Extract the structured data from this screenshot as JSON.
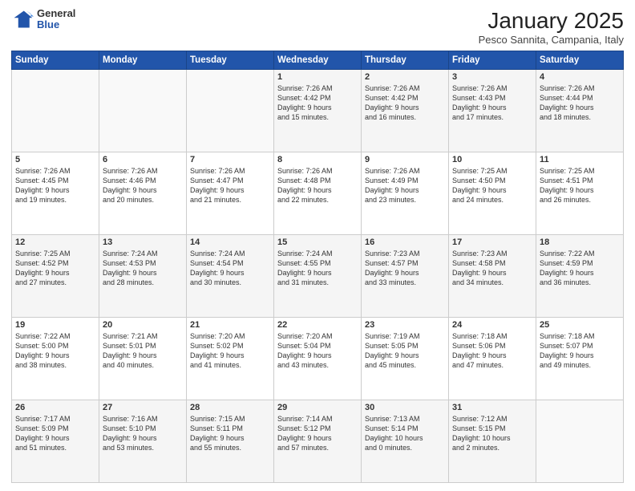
{
  "logo": {
    "general": "General",
    "blue": "Blue"
  },
  "header": {
    "month": "January 2025",
    "location": "Pesco Sannita, Campania, Italy"
  },
  "weekdays": [
    "Sunday",
    "Monday",
    "Tuesday",
    "Wednesday",
    "Thursday",
    "Friday",
    "Saturday"
  ],
  "weeks": [
    [
      {
        "day": "",
        "info": ""
      },
      {
        "day": "",
        "info": ""
      },
      {
        "day": "",
        "info": ""
      },
      {
        "day": "1",
        "info": "Sunrise: 7:26 AM\nSunset: 4:42 PM\nDaylight: 9 hours\nand 15 minutes."
      },
      {
        "day": "2",
        "info": "Sunrise: 7:26 AM\nSunset: 4:42 PM\nDaylight: 9 hours\nand 16 minutes."
      },
      {
        "day": "3",
        "info": "Sunrise: 7:26 AM\nSunset: 4:43 PM\nDaylight: 9 hours\nand 17 minutes."
      },
      {
        "day": "4",
        "info": "Sunrise: 7:26 AM\nSunset: 4:44 PM\nDaylight: 9 hours\nand 18 minutes."
      }
    ],
    [
      {
        "day": "5",
        "info": "Sunrise: 7:26 AM\nSunset: 4:45 PM\nDaylight: 9 hours\nand 19 minutes."
      },
      {
        "day": "6",
        "info": "Sunrise: 7:26 AM\nSunset: 4:46 PM\nDaylight: 9 hours\nand 20 minutes."
      },
      {
        "day": "7",
        "info": "Sunrise: 7:26 AM\nSunset: 4:47 PM\nDaylight: 9 hours\nand 21 minutes."
      },
      {
        "day": "8",
        "info": "Sunrise: 7:26 AM\nSunset: 4:48 PM\nDaylight: 9 hours\nand 22 minutes."
      },
      {
        "day": "9",
        "info": "Sunrise: 7:26 AM\nSunset: 4:49 PM\nDaylight: 9 hours\nand 23 minutes."
      },
      {
        "day": "10",
        "info": "Sunrise: 7:25 AM\nSunset: 4:50 PM\nDaylight: 9 hours\nand 24 minutes."
      },
      {
        "day": "11",
        "info": "Sunrise: 7:25 AM\nSunset: 4:51 PM\nDaylight: 9 hours\nand 26 minutes."
      }
    ],
    [
      {
        "day": "12",
        "info": "Sunrise: 7:25 AM\nSunset: 4:52 PM\nDaylight: 9 hours\nand 27 minutes."
      },
      {
        "day": "13",
        "info": "Sunrise: 7:24 AM\nSunset: 4:53 PM\nDaylight: 9 hours\nand 28 minutes."
      },
      {
        "day": "14",
        "info": "Sunrise: 7:24 AM\nSunset: 4:54 PM\nDaylight: 9 hours\nand 30 minutes."
      },
      {
        "day": "15",
        "info": "Sunrise: 7:24 AM\nSunset: 4:55 PM\nDaylight: 9 hours\nand 31 minutes."
      },
      {
        "day": "16",
        "info": "Sunrise: 7:23 AM\nSunset: 4:57 PM\nDaylight: 9 hours\nand 33 minutes."
      },
      {
        "day": "17",
        "info": "Sunrise: 7:23 AM\nSunset: 4:58 PM\nDaylight: 9 hours\nand 34 minutes."
      },
      {
        "day": "18",
        "info": "Sunrise: 7:22 AM\nSunset: 4:59 PM\nDaylight: 9 hours\nand 36 minutes."
      }
    ],
    [
      {
        "day": "19",
        "info": "Sunrise: 7:22 AM\nSunset: 5:00 PM\nDaylight: 9 hours\nand 38 minutes."
      },
      {
        "day": "20",
        "info": "Sunrise: 7:21 AM\nSunset: 5:01 PM\nDaylight: 9 hours\nand 40 minutes."
      },
      {
        "day": "21",
        "info": "Sunrise: 7:20 AM\nSunset: 5:02 PM\nDaylight: 9 hours\nand 41 minutes."
      },
      {
        "day": "22",
        "info": "Sunrise: 7:20 AM\nSunset: 5:04 PM\nDaylight: 9 hours\nand 43 minutes."
      },
      {
        "day": "23",
        "info": "Sunrise: 7:19 AM\nSunset: 5:05 PM\nDaylight: 9 hours\nand 45 minutes."
      },
      {
        "day": "24",
        "info": "Sunrise: 7:18 AM\nSunset: 5:06 PM\nDaylight: 9 hours\nand 47 minutes."
      },
      {
        "day": "25",
        "info": "Sunrise: 7:18 AM\nSunset: 5:07 PM\nDaylight: 9 hours\nand 49 minutes."
      }
    ],
    [
      {
        "day": "26",
        "info": "Sunrise: 7:17 AM\nSunset: 5:09 PM\nDaylight: 9 hours\nand 51 minutes."
      },
      {
        "day": "27",
        "info": "Sunrise: 7:16 AM\nSunset: 5:10 PM\nDaylight: 9 hours\nand 53 minutes."
      },
      {
        "day": "28",
        "info": "Sunrise: 7:15 AM\nSunset: 5:11 PM\nDaylight: 9 hours\nand 55 minutes."
      },
      {
        "day": "29",
        "info": "Sunrise: 7:14 AM\nSunset: 5:12 PM\nDaylight: 9 hours\nand 57 minutes."
      },
      {
        "day": "30",
        "info": "Sunrise: 7:13 AM\nSunset: 5:14 PM\nDaylight: 10 hours\nand 0 minutes."
      },
      {
        "day": "31",
        "info": "Sunrise: 7:12 AM\nSunset: 5:15 PM\nDaylight: 10 hours\nand 2 minutes."
      },
      {
        "day": "",
        "info": ""
      }
    ]
  ]
}
